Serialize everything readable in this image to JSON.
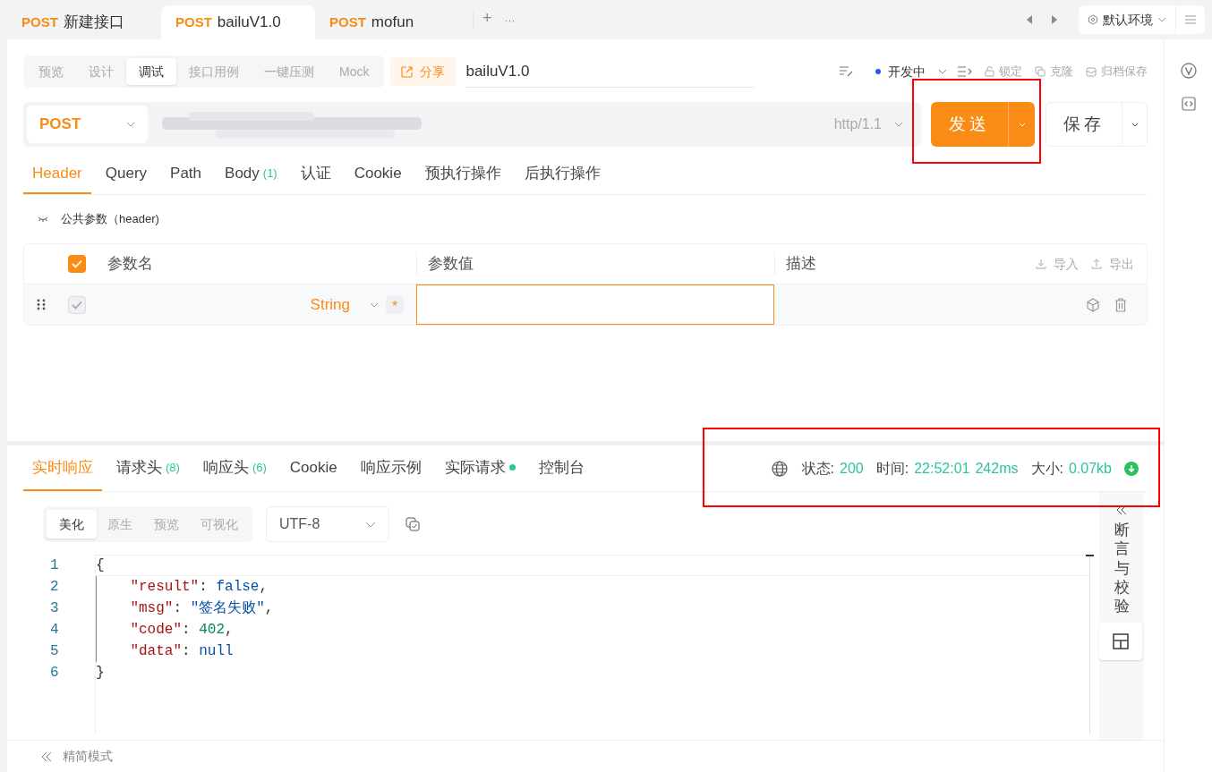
{
  "doc_tabs": [
    {
      "method": "POST",
      "name": "新建接口",
      "selected": false
    },
    {
      "method": "POST",
      "name": "bailuV1.0",
      "selected": true
    },
    {
      "method": "POST",
      "name": "mofun",
      "selected": false
    }
  ],
  "tab_bar_actions": {
    "add": "+",
    "more": "···"
  },
  "environment": {
    "label": "默认环境"
  },
  "mode_tabs": [
    {
      "label": "预览",
      "selected": false
    },
    {
      "label": "设计",
      "selected": false
    },
    {
      "label": "调试",
      "selected": true
    },
    {
      "label": "接口用例",
      "selected": false
    },
    {
      "label": "一键压测",
      "selected": false
    },
    {
      "label": "Mock",
      "selected": false
    }
  ],
  "share_button": "分享",
  "api_name": "bailuV1.0",
  "status": {
    "label": "开发中",
    "color": "#2f54eb"
  },
  "actions": [
    "锁定",
    "克隆",
    "归档保存"
  ],
  "request": {
    "method": "POST",
    "protocol": "http/1.1",
    "send": "发送",
    "save": "保存"
  },
  "request_tabs": [
    {
      "label": "Header",
      "selected": true
    },
    {
      "label": "Query",
      "selected": false
    },
    {
      "label": "Path",
      "selected": false
    },
    {
      "label": "Body",
      "count": "(1)",
      "selected": false
    },
    {
      "label": "认证",
      "selected": false
    },
    {
      "label": "Cookie",
      "selected": false
    },
    {
      "label": "预执行操作",
      "selected": false
    },
    {
      "label": "后执行操作",
      "selected": false
    }
  ],
  "public_params": "公共参数（header)",
  "params_table": {
    "all_checked": true,
    "columns": [
      "参数名",
      "参数值",
      "描述"
    ],
    "import": "导入",
    "export": "导出",
    "rows": [
      {
        "checked": true,
        "type": "String",
        "required": "*"
      }
    ]
  },
  "response_tabs": [
    {
      "label": "实时响应",
      "dot": false,
      "selected": true
    },
    {
      "label": "请求头",
      "count": "(8)",
      "dot": false,
      "selected": false
    },
    {
      "label": "响应头",
      "count": "(6)",
      "dot": false,
      "selected": false
    },
    {
      "label": "Cookie",
      "dot": false,
      "selected": false
    },
    {
      "label": "响应示例",
      "dot": false,
      "selected": false
    },
    {
      "label": "实际请求",
      "dot": true,
      "selected": false
    },
    {
      "label": "控制台",
      "dot": false,
      "selected": false
    }
  ],
  "response_meta": {
    "status_label": "状态:",
    "status": "200",
    "time_label": "时间:",
    "time": "22:52:01",
    "duration": "242ms",
    "size_label": "大小:",
    "size": "0.07kb"
  },
  "view_tabs": [
    {
      "label": "美化",
      "selected": true
    },
    {
      "label": "原生",
      "selected": false
    },
    {
      "label": "预览",
      "selected": false
    },
    {
      "label": "可视化",
      "selected": false
    }
  ],
  "encoding": "UTF-8",
  "code": [
    {
      "n": "1",
      "tokens": [
        {
          "kind": "punct",
          "text": "{"
        }
      ]
    },
    {
      "n": "2",
      "tokens": [
        {
          "kind": "key",
          "text": "    \"result\""
        },
        {
          "kind": "punct",
          "text": ": "
        },
        {
          "kind": "literal",
          "text": "false"
        },
        {
          "kind": "punct",
          "text": ","
        }
      ]
    },
    {
      "n": "3",
      "tokens": [
        {
          "kind": "key",
          "text": "    \"msg\""
        },
        {
          "kind": "punct",
          "text": ": "
        },
        {
          "kind": "string",
          "text": "\"签名失败\""
        },
        {
          "kind": "punct",
          "text": ","
        }
      ]
    },
    {
      "n": "4",
      "tokens": [
        {
          "kind": "key",
          "text": "    \"code\""
        },
        {
          "kind": "punct",
          "text": ": "
        },
        {
          "kind": "number",
          "text": "402"
        },
        {
          "kind": "punct",
          "text": ","
        }
      ]
    },
    {
      "n": "5",
      "tokens": [
        {
          "kind": "key",
          "text": "    \"data\""
        },
        {
          "kind": "punct",
          "text": ": "
        },
        {
          "kind": "literal",
          "text": "null"
        }
      ]
    },
    {
      "n": "6",
      "tokens": [
        {
          "kind": "punct",
          "text": "}"
        }
      ]
    }
  ],
  "side_panel": {
    "label": "断言与校验"
  },
  "footer": {
    "label": "精简模式"
  }
}
